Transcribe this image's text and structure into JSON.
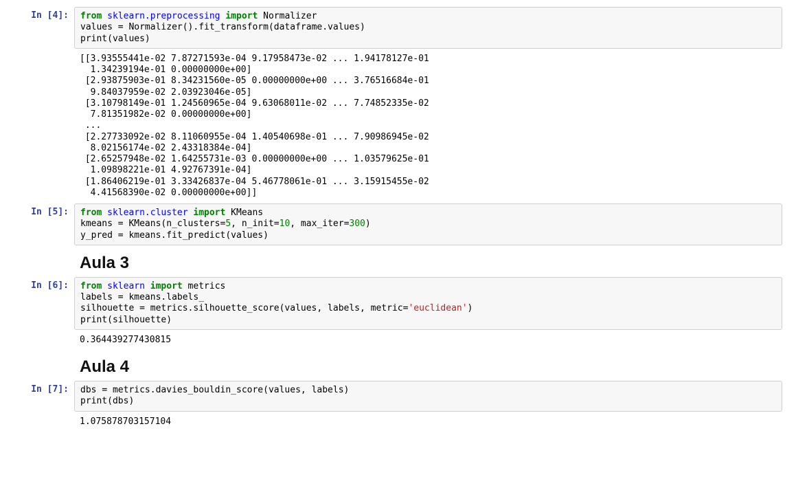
{
  "cells": {
    "c4": {
      "prompt": "In [4]:",
      "tokens": [
        {
          "t": "from",
          "c": "kw-green"
        },
        {
          "t": " "
        },
        {
          "t": "sklearn.preprocessing",
          "c": "kw-blue"
        },
        {
          "t": " "
        },
        {
          "t": "import",
          "c": "kw-green"
        },
        {
          "t": " Normalizer\n"
        },
        {
          "t": "values "
        },
        {
          "t": "="
        },
        {
          "t": " Normalizer()"
        },
        {
          "t": "."
        },
        {
          "t": "fit_transform(dataframe"
        },
        {
          "t": "."
        },
        {
          "t": "values)\n"
        },
        {
          "t": "print",
          "c": "fn"
        },
        {
          "t": "(values)"
        }
      ],
      "output": "[[3.93555441e-02 7.87271593e-04 9.17958473e-02 ... 1.94178127e-01\n  1.34239194e-01 0.00000000e+00]\n [2.93875903e-01 8.34231560e-05 0.00000000e+00 ... 3.76516684e-01\n  9.84037959e-02 2.03923046e-05]\n [3.10798149e-01 1.24560965e-04 9.63068011e-02 ... 7.74852335e-02\n  7.81351982e-02 0.00000000e+00]\n ...\n [2.27733092e-02 8.11060955e-04 1.40540698e-01 ... 7.90986945e-02\n  8.02156174e-02 2.43318384e-04]\n [2.65257948e-02 1.64255731e-03 0.00000000e+00 ... 1.03579625e-01\n  1.09898221e-01 4.92767391e-04]\n [1.86406219e-01 3.33426837e-04 5.46778061e-01 ... 3.15915455e-02\n  4.41568390e-02 0.00000000e+00]]"
    },
    "c5": {
      "prompt": "In [5]:",
      "tokens": [
        {
          "t": "from",
          "c": "kw-green"
        },
        {
          "t": " "
        },
        {
          "t": "sklearn.cluster",
          "c": "kw-blue"
        },
        {
          "t": " "
        },
        {
          "t": "import",
          "c": "kw-green"
        },
        {
          "t": " KMeans\n"
        },
        {
          "t": "kmeans "
        },
        {
          "t": "="
        },
        {
          "t": " KMeans(n_clusters"
        },
        {
          "t": "="
        },
        {
          "t": "5",
          "c": "num"
        },
        {
          "t": ", n_init"
        },
        {
          "t": "="
        },
        {
          "t": "10",
          "c": "num"
        },
        {
          "t": ", max_iter"
        },
        {
          "t": "="
        },
        {
          "t": "300",
          "c": "num"
        },
        {
          "t": ")\n"
        },
        {
          "t": "y_pred "
        },
        {
          "t": "="
        },
        {
          "t": " kmeans"
        },
        {
          "t": "."
        },
        {
          "t": "fit_predict(values)"
        }
      ]
    },
    "h3": {
      "title": "Aula 3"
    },
    "c6": {
      "prompt": "In [6]:",
      "tokens": [
        {
          "t": "from",
          "c": "kw-green"
        },
        {
          "t": " "
        },
        {
          "t": "sklearn",
          "c": "kw-blue"
        },
        {
          "t": " "
        },
        {
          "t": "import",
          "c": "kw-green"
        },
        {
          "t": " metrics\n"
        },
        {
          "t": "labels "
        },
        {
          "t": "="
        },
        {
          "t": " kmeans"
        },
        {
          "t": "."
        },
        {
          "t": "labels_\n"
        },
        {
          "t": "silhouette "
        },
        {
          "t": "="
        },
        {
          "t": " metrics"
        },
        {
          "t": "."
        },
        {
          "t": "silhouette_score(values, labels, metric"
        },
        {
          "t": "="
        },
        {
          "t": "'euclidean'",
          "c": "str"
        },
        {
          "t": ")\n"
        },
        {
          "t": "print",
          "c": "fn"
        },
        {
          "t": "(silhouette)"
        }
      ],
      "output": "0.364439277430815"
    },
    "h4": {
      "title": "Aula 4"
    },
    "c7": {
      "prompt": "In [7]:",
      "tokens": [
        {
          "t": "dbs "
        },
        {
          "t": "="
        },
        {
          "t": " metrics"
        },
        {
          "t": "."
        },
        {
          "t": "davies_bouldin_score(values, labels)\n"
        },
        {
          "t": "print",
          "c": "fn"
        },
        {
          "t": "(dbs)"
        }
      ],
      "output": "1.075878703157104"
    }
  }
}
